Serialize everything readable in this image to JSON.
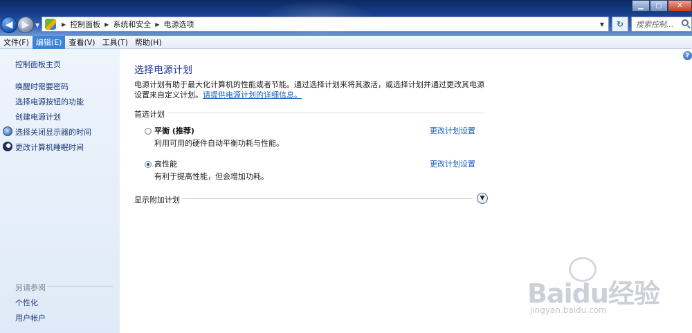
{
  "window": {
    "controls": {
      "minimize": "▁",
      "maximize": "▢",
      "close": "✕"
    }
  },
  "address": {
    "breadcrumb": [
      "控制面板",
      "系统和安全",
      "电源选项"
    ],
    "search_placeholder": "搜索控制..."
  },
  "menu": {
    "items": [
      "文件(F)",
      "编辑(E)",
      "查看(V)",
      "工具(T)",
      "帮助(H)"
    ],
    "active_index": 1
  },
  "sidebar": {
    "home": "控制面板主页",
    "links": [
      "唤醒时需要密码",
      "选择电源按钮的功能",
      "创建电源计划",
      "选择关闭显示器的时间",
      "更改计算机睡眠时间"
    ],
    "see_also_title": "另请参阅",
    "see_also": [
      "个性化",
      "用户帐户"
    ]
  },
  "main": {
    "title": "选择电源计划",
    "description": "电源计划有助于最大化计算机的性能或者节能。通过选择计划来将其激活，或选择计划并通过更改其电源设置来自定义计划。",
    "description_link": "请提供电源计划的详细信息。",
    "preferred_label": "首选计划",
    "plans": [
      {
        "name": "平衡 (推荐)",
        "desc": "利用可用的硬件自动平衡功耗与性能。",
        "link": "更改计划设置",
        "selected": false
      },
      {
        "name": "高性能",
        "desc": "有利于提高性能，但会增加功耗。",
        "link": "更改计划设置",
        "selected": true
      }
    ],
    "more_label": "显示附加计划"
  },
  "icons": {
    "back": "back-arrow-icon",
    "forward": "forward-arrow-icon",
    "refresh": "refresh-icon",
    "search": "search-icon",
    "help": "help-icon",
    "expand": "chevron-down-icon"
  },
  "watermark": {
    "text": "Baidu经验",
    "sub": "jingyan.baidu.com"
  }
}
